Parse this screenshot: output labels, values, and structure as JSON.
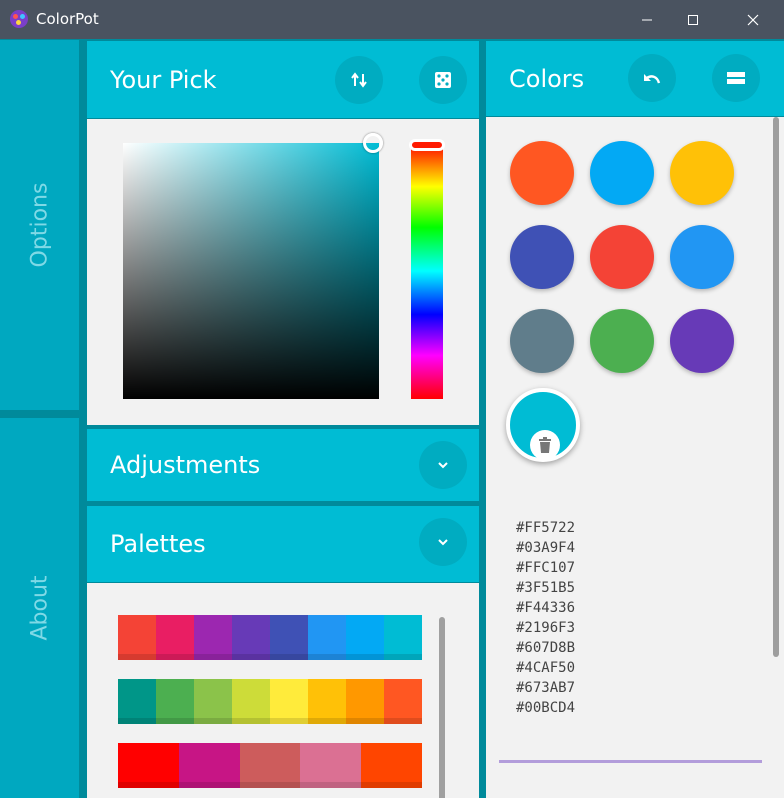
{
  "window": {
    "title": "ColorPot"
  },
  "sidebar": {
    "options_label": "Options",
    "about_label": "About"
  },
  "pick": {
    "title": "Your Pick",
    "swap_icon": "swap-vertical-icon",
    "random_icon": "dice-icon",
    "hue_color": "#00bcd4"
  },
  "adjustments": {
    "title": "Adjustments"
  },
  "palettes": {
    "title": "Palettes",
    "rows": [
      [
        "#F44336",
        "#E91E63",
        "#9C27B0",
        "#673AB7",
        "#3F51B5",
        "#2196F3",
        "#03A9F4",
        "#00BCD4"
      ],
      [
        "#009688",
        "#4CAF50",
        "#8BC34A",
        "#CDDC39",
        "#FFEB3B",
        "#FFC107",
        "#FF9800",
        "#FF5722"
      ],
      [
        "#FF0000",
        "#C71585",
        "#CD5C5C",
        "#DB7093",
        "#FF4500"
      ]
    ]
  },
  "colors": {
    "title": "Colors",
    "undo_icon": "undo-icon",
    "menu_icon": "menu-icon",
    "swatches": [
      "#FF5722",
      "#03A9F4",
      "#FFC107",
      "#3F51B5",
      "#F44336",
      "#2196F3",
      "#607D8B",
      "#4CAF50",
      "#673AB7",
      "#00BCD4"
    ],
    "hex_list": [
      "#FF5722",
      "#03A9F4",
      "#FFC107",
      "#3F51B5",
      "#F44336",
      "#2196F3",
      "#607D8B",
      "#4CAF50",
      "#673AB7",
      "#00BCD4"
    ]
  }
}
